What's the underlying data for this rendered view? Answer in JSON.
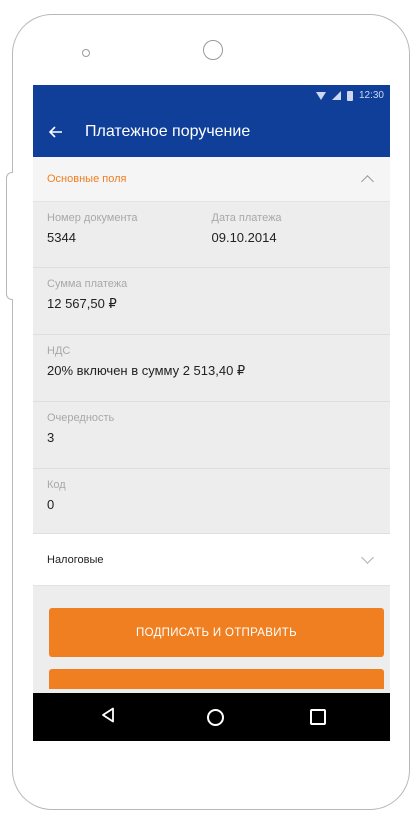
{
  "status_bar": {
    "time": "12:30"
  },
  "app_bar": {
    "title": "Платежное поручение",
    "back_icon": "arrow-left-icon"
  },
  "section_main": {
    "label": "Основные поля",
    "expanded": true
  },
  "fields": {
    "doc_number": {
      "label": "Номер документа",
      "value": "5344"
    },
    "payment_date": {
      "label": "Дата платежа",
      "value": "09.10.2014"
    },
    "amount": {
      "label": "Сумма платежа",
      "value": "12 567,50 ₽"
    },
    "vat": {
      "label": "НДС",
      "value": "20% включен в сумму 2 513,40 ₽"
    },
    "priority": {
      "label": "Очередность",
      "value": "3"
    },
    "code": {
      "label": "Код",
      "value": "0"
    }
  },
  "section_tax": {
    "label": "Налоговые",
    "expanded": false
  },
  "actions": {
    "sign_send_label": "ПОДПИСАТЬ И ОТПРАВИТЬ"
  },
  "colors": {
    "primary": "#0f3f99",
    "accent": "#f07f22",
    "background": "#ededed"
  }
}
